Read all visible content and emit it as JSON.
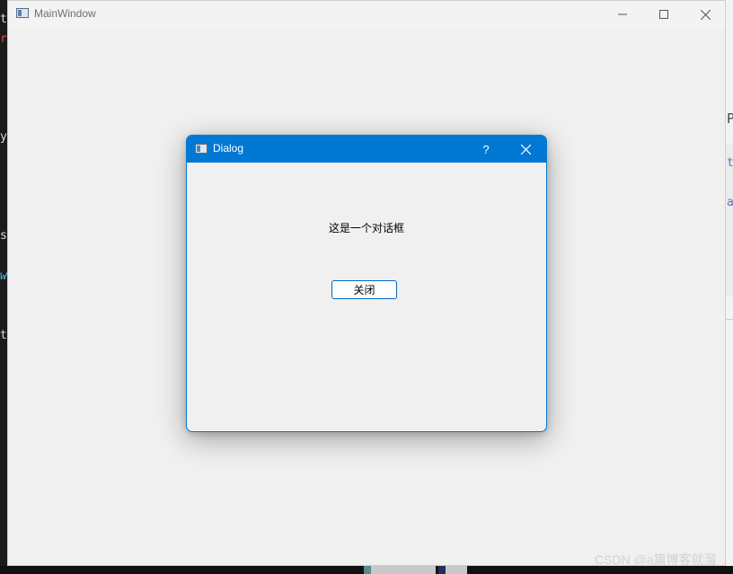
{
  "main_window": {
    "title": "MainWindow",
    "icon": "app-window-icon"
  },
  "dialog": {
    "title": "Dialog",
    "help_label": "?",
    "message": "这是一个对话框",
    "close_button_label": "关闭"
  },
  "background_fragments": {
    "left": [
      "t",
      "r",
      "y(",
      "sh",
      "w",
      "te"
    ],
    "right": [
      "Pl",
      "to",
      "a"
    ]
  },
  "watermark": "CSDN @a篇博客就溜",
  "colors": {
    "accent": "#0078d4",
    "window_bg": "#f0f0f0",
    "titlebar_bg": "#f3f3f3"
  }
}
